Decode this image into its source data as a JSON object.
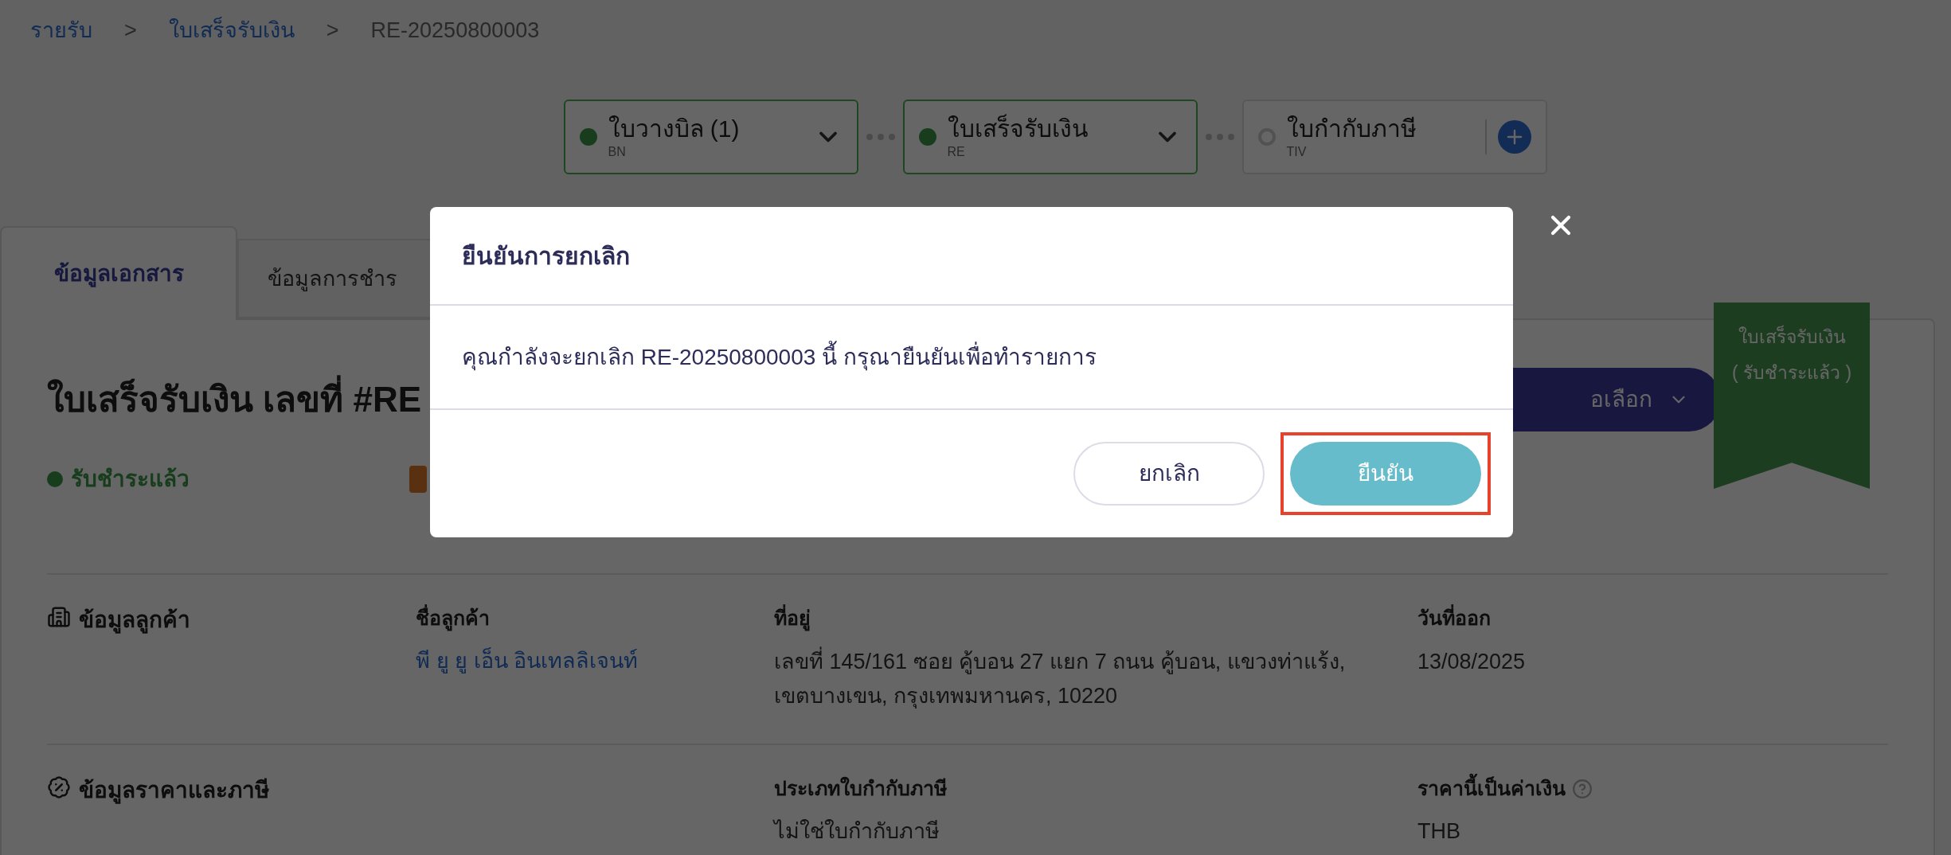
{
  "breadcrumb": [
    {
      "label": "รายรับ",
      "kind": "link"
    },
    {
      "label": "ใบเสร็จรับเงิน",
      "kind": "link"
    },
    {
      "label": "RE-20250800003",
      "kind": "current"
    }
  ],
  "breadcrumb_separator": ">",
  "doc_flow": [
    {
      "title": "ใบวางบิล (1)",
      "code": "BN",
      "kind": "linked"
    },
    {
      "title": "ใบเสร็จรับเงิน",
      "code": "RE",
      "kind": "linked"
    },
    {
      "title": "ใบกำกับภาษี",
      "code": "TIV",
      "kind": "addable"
    }
  ],
  "tabs": [
    {
      "label": "ข้อมูลเอกสาร",
      "selected": true
    },
    {
      "label": "ข้อมูลการชำร",
      "selected": false
    }
  ],
  "document": {
    "title": "ใบเสร็จรับเงิน เลขที่ #RE",
    "status": "รับชำระแล้ว",
    "options_button": "อเลือก",
    "ribbon": [
      "ใบเสร็จรับเงิน",
      "( รับชำระแล้ว )"
    ]
  },
  "sections": [
    {
      "title": "ข้อมูลลูกค้า",
      "fields": [
        {
          "label": "ชื่อลูกค้า",
          "value": "พี ยู ยู เอ็น อินเทลลิเจนท์",
          "kind": "link"
        },
        {
          "label": "ที่อยู่",
          "value": "เลขที่ 145/161 ซอย คู้บอน 27 แยก 7 ถนน คู้บอน, แขวงท่าแร้ง, เขตบางเขน, กรุงเทพมหานคร, 10220",
          "kind": "text"
        },
        {
          "label": "วันที่ออก",
          "value": "13/08/2025",
          "kind": "text"
        }
      ]
    },
    {
      "title": "ข้อมูลราคาและภาษี",
      "fields": [
        {
          "label": "ประเภทใบกำกับภาษี",
          "value": "ไม่ใช่ใบกำกับภาษี",
          "kind": "text"
        },
        {
          "label": "ราคานี้เป็นค่าเงิน",
          "value": "THB",
          "kind": "text",
          "help": true
        }
      ]
    }
  ],
  "modal": {
    "title": "ยืนยันการยกเลิก",
    "message": "คุณกำลังจะยกเลิก RE-20250800003 นี้ กรุณายืนยันเพื่อทำรายการ",
    "buttons": [
      {
        "label": "ยกเลิก",
        "kind": "secondary",
        "highlighted": false
      },
      {
        "label": "ยืนยัน",
        "kind": "primary",
        "highlighted": true
      }
    ]
  }
}
